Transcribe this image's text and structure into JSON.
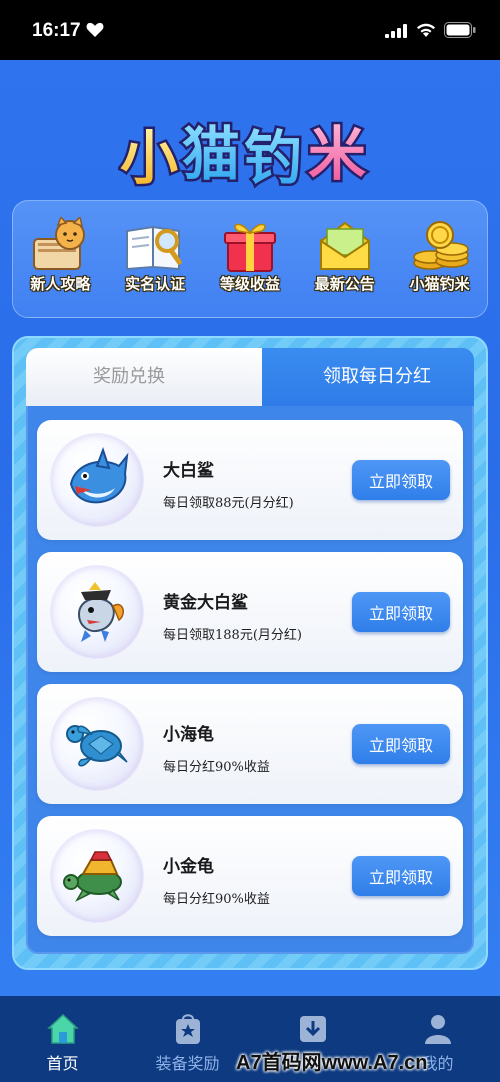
{
  "status_bar": {
    "time": "16:17",
    "icons": [
      "heart-icon",
      "signal-icon",
      "wifi-icon",
      "battery-icon"
    ]
  },
  "app": {
    "logo_text": "小猫钓米"
  },
  "shortcuts": [
    {
      "label": "新人攻略",
      "icon": "cat-scroll-icon"
    },
    {
      "label": "实名认证",
      "icon": "book-magnifier-icon"
    },
    {
      "label": "等级收益",
      "icon": "gift-box-icon"
    },
    {
      "label": "最新公告",
      "icon": "envelope-icon"
    },
    {
      "label": "小猫钓米",
      "icon": "gold-coins-icon"
    }
  ],
  "tabs": {
    "left": "奖励兑换",
    "right": "领取每日分红",
    "active": "right"
  },
  "cards": [
    {
      "title": "大白鲨",
      "desc": "每日领取88元(月分红)",
      "button": "立即领取",
      "icon": "shark-icon"
    },
    {
      "title": "黄金大白鲨",
      "desc": "每日领取188元(月分红)",
      "button": "立即领取",
      "icon": "golden-shark-icon"
    },
    {
      "title": "小海龟",
      "desc": "每日分红90%收益",
      "button": "立即领取",
      "icon": "sea-turtle-icon"
    },
    {
      "title": "小金龟",
      "desc": "每日分红90%收益",
      "button": "立即领取",
      "icon": "golden-turtle-icon"
    }
  ],
  "bottom_nav": [
    {
      "label": "首页",
      "icon": "home-icon",
      "active": true
    },
    {
      "label": "装备奖励",
      "icon": "gift-bag-icon",
      "active": false
    },
    {
      "label": "",
      "icon": "download-icon",
      "active": false
    },
    {
      "label": "我的",
      "icon": "user-icon",
      "active": false
    }
  ],
  "watermark": "A7首码网www.A7.cn",
  "colors": {
    "background": "#2f73ee",
    "button": "#2f7ee9",
    "nav_bg": "#0d3a80",
    "panel_stripe": "#5ec0f5"
  }
}
